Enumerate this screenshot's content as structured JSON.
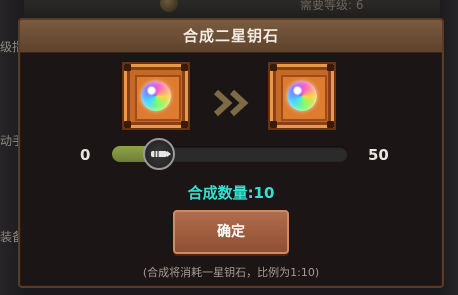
{
  "background": {
    "top_text": "需要等级: 6",
    "left_labels": [
      "级指",
      "动手",
      "装备"
    ]
  },
  "dialog": {
    "title": "合成二星钥石",
    "source_item": {
      "icon": "rainbow-orb"
    },
    "target_item": {
      "icon": "rainbow-orb"
    },
    "slider": {
      "min_label": "0",
      "max_label": "50",
      "min": 0,
      "max": 50,
      "value": 10
    },
    "count_label": "合成数量:10",
    "confirm_label": "确定",
    "note": "(合成将消耗一星钥石，比例为1:10)"
  },
  "colors": {
    "title_bar": "#6b4d33",
    "accent_cyan": "#35e0d2",
    "slot_orange": "#c46a26",
    "slider_fill": "#7f9240",
    "button": "#a15e40"
  }
}
